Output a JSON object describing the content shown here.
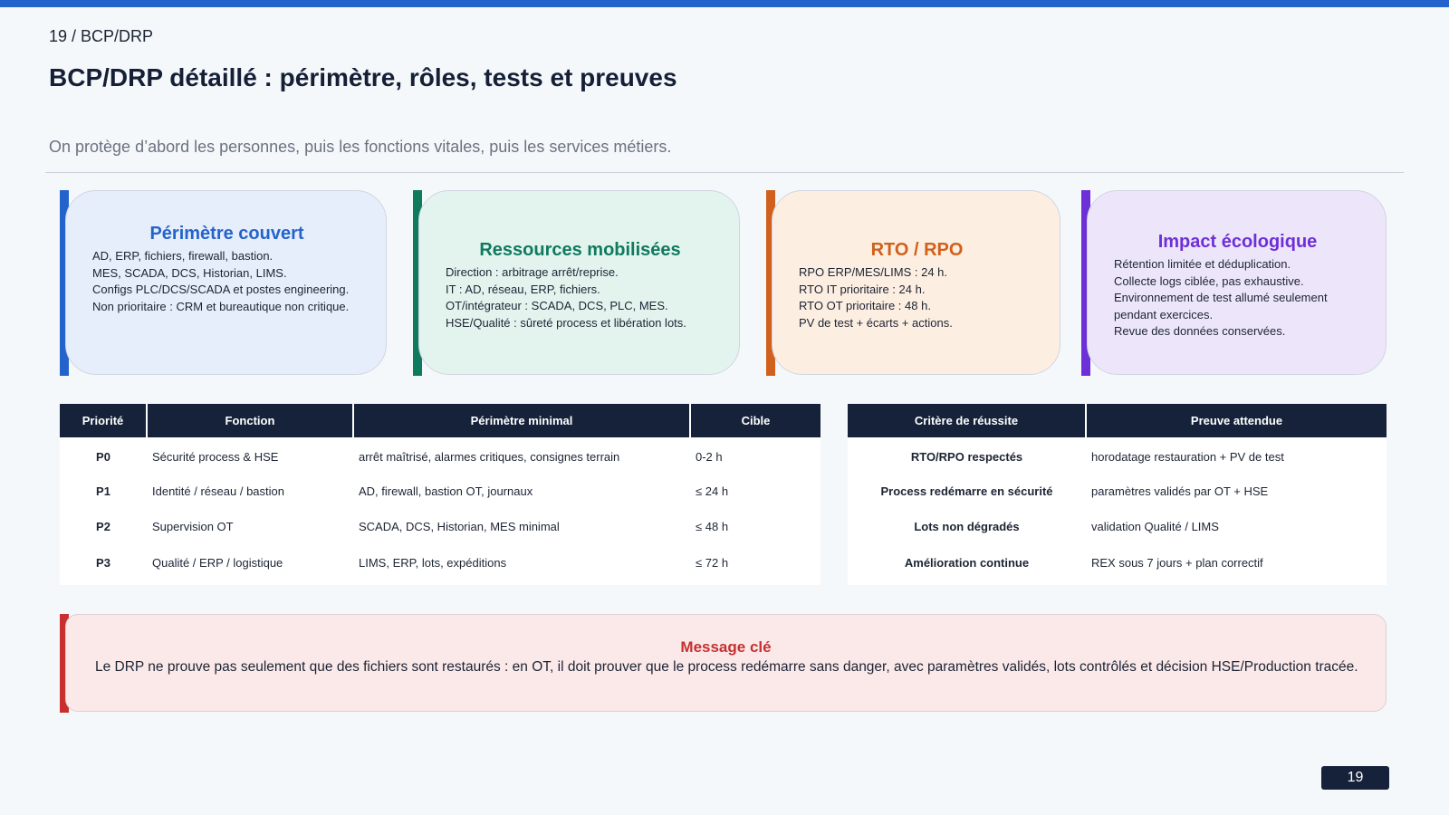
{
  "header": {
    "section": "19 / BCP/DRP",
    "title": "BCP/DRP détaillé : périmètre, rôles, tests et preuves",
    "subtitle": "On protège d’abord les personnes, puis les fonctions vitales, puis les services métiers."
  },
  "cards": [
    {
      "title": "Périmètre couvert",
      "accent": "#2563cc",
      "background": "#e6eefb",
      "items": [
        "AD, ERP, fichiers, firewall, bastion.",
        "MES, SCADA, DCS, Historian, LIMS.",
        "Configs PLC/DCS/SCADA et postes engineering.",
        "Non prioritaire : CRM et bureautique non critique."
      ]
    },
    {
      "title": "Ressources mobilisées",
      "accent": "#0f7a5e",
      "background": "#e3f4ef",
      "items": [
        "Direction : arbitrage arrêt/reprise.",
        "IT : AD, réseau, ERP, fichiers.",
        "OT/intégrateur : SCADA, DCS, PLC, MES.",
        "HSE/Qualité : sûreté process et libération lots."
      ]
    },
    {
      "title": "RTO / RPO",
      "accent": "#d0601b",
      "background": "#fdeee2",
      "items": [
        "RPO ERP/MES/LIMS : 24 h.",
        "RTO IT prioritaire : 24 h.",
        "RTO OT prioritaire : 48 h.",
        "PV de test + écarts + actions."
      ]
    },
    {
      "title": "Impact écologique",
      "accent": "#6d2fd8",
      "background": "#ede6fb",
      "items": [
        "Rétention limitée et déduplication.",
        "Collecte logs ciblée, pas exhaustive.",
        "Environnement de test allumé seulement pendant exercices.",
        "Revue des données conservées."
      ]
    }
  ],
  "priority_table": {
    "headers": [
      "Priorité",
      "Fonction",
      "Périmètre minimal",
      "Cible"
    ],
    "rows": [
      [
        "P0",
        "Sécurité process & HSE",
        "arrêt maîtrisé, alarmes critiques, consignes terrain",
        "0-2 h"
      ],
      [
        "P1",
        "Identité / réseau / bastion",
        "AD, firewall, bastion OT, journaux",
        "≤ 24 h"
      ],
      [
        "P2",
        "Supervision OT",
        "SCADA, DCS, Historian, MES minimal",
        "≤ 48 h"
      ],
      [
        "P3",
        "Qualité / ERP / logistique",
        "LIMS, ERP, lots, expéditions",
        "≤ 72 h"
      ]
    ]
  },
  "criteria_table": {
    "headers": [
      "Critère de réussite",
      "Preuve attendue"
    ],
    "rows": [
      [
        "RTO/RPO respectés",
        "horodatage restauration + PV de test"
      ],
      [
        "Process redémarre en sécurité",
        "paramètres validés par OT + HSE"
      ],
      [
        "Lots non dégradés",
        "validation Qualité / LIMS"
      ],
      [
        "Amélioration continue",
        "REX sous 7 jours + plan correctif"
      ]
    ]
  },
  "message": {
    "title": "Message clé",
    "text": "Le DRP ne prouve pas seulement que des fichiers sont restaurés : en OT, il doit prouver que le process redémarre sans danger, avec paramètres validés, lots contrôlés et décision HSE/Production tracée."
  },
  "page_number": "19"
}
